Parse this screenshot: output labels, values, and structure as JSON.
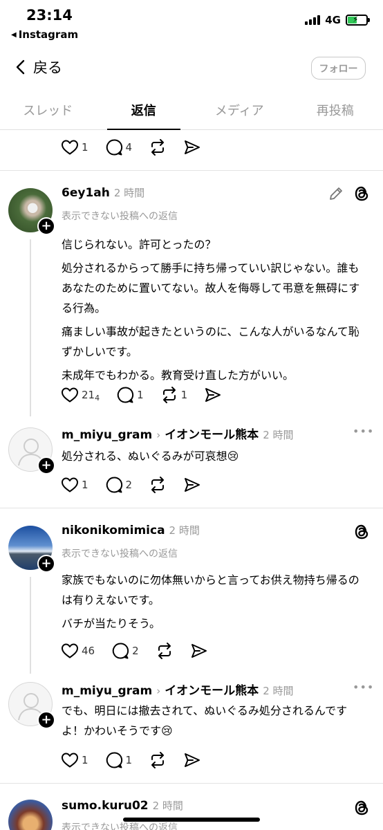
{
  "status": {
    "time": "23:14",
    "back_app": "Instagram",
    "network": "4G"
  },
  "nav": {
    "back_label": "戻る",
    "follow_label": "フォロー"
  },
  "tabs": [
    {
      "label": "スレッド"
    },
    {
      "label": "返信"
    },
    {
      "label": "メディア"
    },
    {
      "label": "再投稿"
    }
  ],
  "top_post": {
    "likes": "1",
    "replies": "4"
  },
  "posts": [
    {
      "username": "6ey1ah",
      "time": "2 時間",
      "subtitle": "表示できない投稿への返信",
      "lines": [
        "信じられない。許可とったの？",
        "処分されるからって勝手に持ち帰っていい訳じゃない。誰もあなたのために置いてない。故人を侮辱して弔意を無碍にする行為。",
        "痛ましい事故が起きたというのに、こんな人がいるなんて恥ずかしいです。",
        "未成年でもわかる。教育受け直した方がいい。"
      ],
      "likes": "21",
      "likes_sub": "4",
      "replies": "1",
      "reposts": "1"
    },
    {
      "username": "m_miyu_gram",
      "reply_to": "イオンモール熊本",
      "time": "2 時間",
      "lines": [
        "処分される、ぬいぐるみが可哀想😢"
      ],
      "likes": "1",
      "replies": "2"
    },
    {
      "username": "nikonikomimica",
      "time": "2 時間",
      "subtitle": "表示できない投稿への返信",
      "lines": [
        "家族でもないのに勿体無いからと言ってお供え物持ち帰るのは有りえないです。",
        "バチが当たりそう。"
      ],
      "likes": "46",
      "replies": "2"
    },
    {
      "username": "m_miyu_gram",
      "reply_to": "イオンモール熊本",
      "time": "2 時間",
      "lines": [
        "でも、明日には撤去されて、ぬいぐるみ処分されるんですよ！かわいそうです😢"
      ],
      "likes": "1",
      "replies": "1"
    },
    {
      "username": "sumo.kuru02",
      "time": "2 時間",
      "subtitle": "表示できない投稿への返信"
    }
  ],
  "icons": {
    "heart": "heart-icon",
    "comment": "comment-icon",
    "repost": "repost-icon",
    "share": "share-icon",
    "threads": "threads-logo-icon",
    "edit": "pencil-icon",
    "more": "more-icon"
  }
}
